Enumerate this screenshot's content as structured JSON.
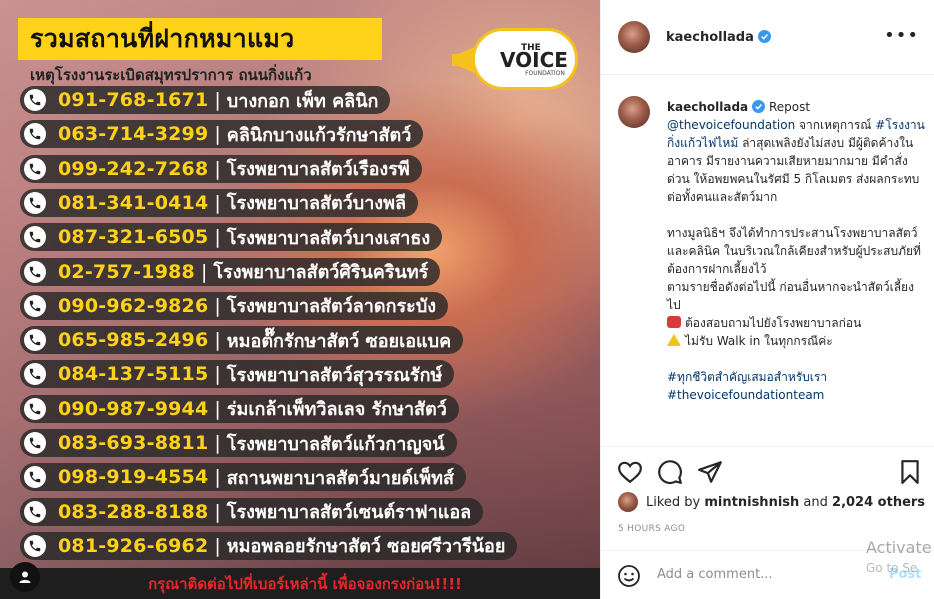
{
  "image": {
    "title": "รวมสถานที่ฝากหมาแมว",
    "subtitle": "เหตุโรงงานระเบิดสมุทรปราการ ถนนกิ่งแก้ว",
    "logo": {
      "the": "THE",
      "voice": "VOICE",
      "foundation": "FOUNDATION"
    },
    "contacts": [
      {
        "phone": "091-768-1671",
        "name": "บางกอก เพ็ท คลินิก"
      },
      {
        "phone": "063-714-3299",
        "name": "คลินิกบางแก้วรักษาสัตว์"
      },
      {
        "phone": "099-242-7268",
        "name": "โรงพยาบาลสัตว์เรืองรพี"
      },
      {
        "phone": "081-341-0414",
        "name": "โรงพยาบาลสัตว์บางพลี"
      },
      {
        "phone": "087-321-6505",
        "name": "โรงพยาบาลสัตว์บางเสาธง"
      },
      {
        "phone": "02-757-1988",
        "name": "โรงพยาบาลสัตว์ศิรินครินทร์"
      },
      {
        "phone": "090-962-9826",
        "name": "โรงพยาบาลสัตว์ลาดกระบัง"
      },
      {
        "phone": "065-985-2496",
        "name": "หมอต๊๊กรักษาสัตว์ ซอยเอแบค"
      },
      {
        "phone": "084-137-5115",
        "name": "โรงพยาบาลสัตว์สุวรรณรักษ์"
      },
      {
        "phone": "090-987-9944",
        "name": "ร่มเกล้าเพ็ทวิลเลจ รักษาสัตว์"
      },
      {
        "phone": "083-693-8811",
        "name": "โรงพยาบาลสัตว์แก้วกาญจน์"
      },
      {
        "phone": "098-919-4554",
        "name": "สถานพยาบาลสัตว์มายด์เพ็ทส์"
      },
      {
        "phone": "083-288-8188",
        "name": "โรงพยาบาลสัตว์เซนต์ราฟาแอล"
      },
      {
        "phone": "081-926-6962",
        "name": "หมอพลอยรักษาสัตว์ ซอยศรีวารีน้อย"
      }
    ],
    "footer": "กรุณาติดต่อไปที่เบอร์เหล่านี้ เพื่อจองกรงก่อน!!!!"
  },
  "header": {
    "username": "kaechollada"
  },
  "caption": {
    "username": "kaechollada",
    "repost": "Repost",
    "mention": "@thevoicefoundation",
    "line1": " จากเหตุการณ์",
    "hashtag1": "#โรงงานกิ่งแก้วไฟไหม้",
    "body1": " ล่าสุดเพลิงยังไม่สงบ มีผู้ติดค้างในอาคาร มีรายงานความเสียหายมากมาย มีคำสั่งด่วน ให้อพยพคนในรัศมี 5 กิโลเมตร ส่งผลกระทบต่อทั้งคนและสัตว์มาก",
    "body2": "ทางมูลนิธิฯ จึงได้ทำการประสานโรงพยาบาลสัตว์ และคลินิค ในบริเวณใกล้เคียงสำหรับผู้ประสบภัยที่ต้องการฝากเลี้ยงไว้",
    "body3": "ตามรายชื่อดังต่อไปนี้ ก่อนอื่นหากจะนำสัตว์เลี้ยงไป",
    "note1": "ต้องสอบถามไปยังโรงพยาบาลก่อน",
    "note2": "ไม่รับ Walk in ในทุกกรณีค่ะ",
    "hashtag2": "#ทุกชีวิตสำคัญเสมอสำหรับเรา",
    "hashtag3": "#thevoicefoundationteam"
  },
  "likes": {
    "prefix": "Liked by ",
    "user": "mintnishnish",
    "mid": " and ",
    "count": "2,024 others"
  },
  "timestamp": "5 HOURS AGO",
  "comment": {
    "placeholder": "Add a comment...",
    "post_label": "Post"
  },
  "watermark": {
    "line1": "Activate",
    "line2": "Go to Se"
  },
  "colors": {
    "accent_yellow": "#ffd21a",
    "link_blue": "#00376b",
    "verified_blue": "#3897f0",
    "footer_red": "#e8262a"
  }
}
